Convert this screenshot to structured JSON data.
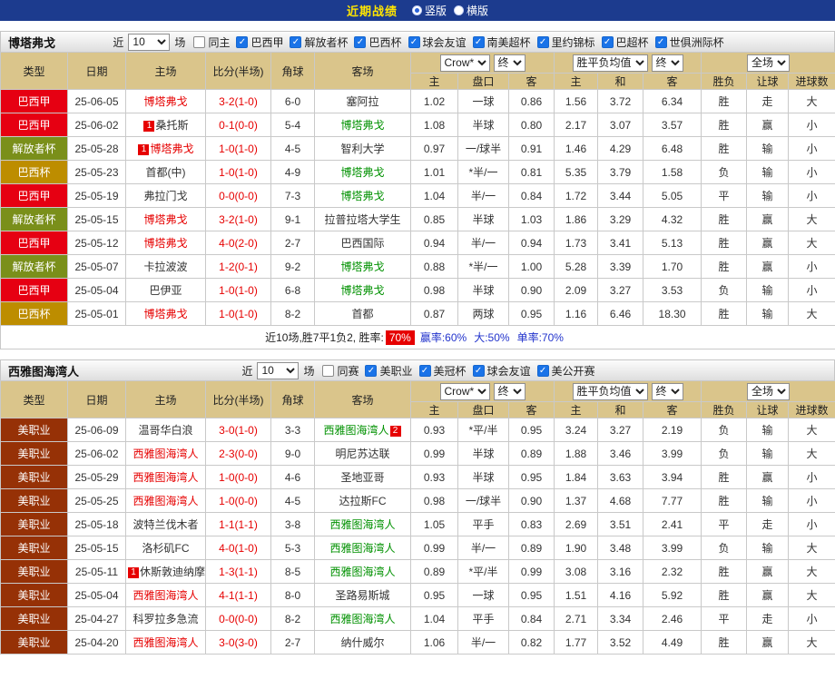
{
  "top_bar": {
    "title": "近期战绩",
    "layout_options": [
      {
        "label": "竖版",
        "selected": true
      },
      {
        "label": "横版",
        "selected": false
      }
    ]
  },
  "filter_labels": {
    "near": "近",
    "count": "10",
    "games": "场"
  },
  "table_headers": {
    "type": "类型",
    "date": "日期",
    "home": "主场",
    "score": "比分(半场)",
    "corners": "角球",
    "away": "客场",
    "odds_group": {
      "select1": "Crow*",
      "select2": "终"
    },
    "avg_group": {
      "select1": "胜平负均值",
      "select2": "终"
    },
    "result_group": {
      "select1": "全场"
    },
    "sub": [
      "主",
      "盘口",
      "客",
      "主",
      "和",
      "客",
      "胜负",
      "让球",
      "进球数"
    ]
  },
  "league_colors": {
    "巴西甲": "#e60012",
    "解放者杯": "#7a8f1a",
    "巴西杯": "#bd8d00",
    "美职业": "#963106"
  },
  "colors": {
    "positive_red": "#e60000",
    "negative_green": "#009100",
    "neutral_blue": "#3333cc",
    "header_tan": "#dac58b",
    "topbar_navy": "#1c3b8e",
    "title_yellow": "#ffe500"
  },
  "sections": [
    {
      "team": "博塔弗戈",
      "filters": [
        {
          "label": "同主",
          "checked": false
        },
        {
          "label": "巴西甲",
          "checked": true
        },
        {
          "label": "解放者杯",
          "checked": true
        },
        {
          "label": "巴西杯",
          "checked": true
        },
        {
          "label": "球会友谊",
          "checked": true
        },
        {
          "label": "南美超杯",
          "checked": true
        },
        {
          "label": "里约锦标",
          "checked": true
        },
        {
          "label": "巴超杯",
          "checked": true
        },
        {
          "label": "世俱洲际杯",
          "checked": true
        }
      ],
      "rows": [
        {
          "league": "巴西甲",
          "date": "25-06-05",
          "home": {
            "name": "博塔弗戈",
            "focus": true,
            "badge": null
          },
          "score": "3-2(1-0)",
          "corners": "6-0",
          "away": {
            "name": "塞阿拉",
            "focus": false,
            "badge": null
          },
          "odds": [
            "1.02",
            "一球",
            "0.86"
          ],
          "handicap_red": false,
          "avg": [
            "1.56",
            "3.72",
            "6.34"
          ],
          "results": [
            "胜",
            "走",
            "大"
          ]
        },
        {
          "league": "巴西甲",
          "date": "25-06-02",
          "home": {
            "name": "桑托斯",
            "focus": false,
            "badge": "1"
          },
          "score": "0-1(0-0)",
          "corners": "5-4",
          "away": {
            "name": "博塔弗戈",
            "focus": true,
            "badge": null
          },
          "odds": [
            "1.08",
            "半球",
            "0.80"
          ],
          "handicap_red": false,
          "avg": [
            "2.17",
            "3.07",
            "3.57"
          ],
          "results": [
            "胜",
            "赢",
            "小"
          ]
        },
        {
          "league": "解放者杯",
          "date": "25-05-28",
          "home": {
            "name": "博塔弗戈",
            "focus": true,
            "badge": "1"
          },
          "score": "1-0(1-0)",
          "corners": "4-5",
          "away": {
            "name": "智利大学",
            "focus": false,
            "badge": null
          },
          "odds": [
            "0.97",
            "一/球半",
            "0.91"
          ],
          "handicap_red": false,
          "avg": [
            "1.46",
            "4.29",
            "6.48"
          ],
          "results": [
            "胜",
            "输",
            "小"
          ]
        },
        {
          "league": "巴西杯",
          "date": "25-05-23",
          "home": {
            "name": "首都(中)",
            "focus": false,
            "badge": null
          },
          "score": "1-0(1-0)",
          "corners": "4-9",
          "away": {
            "name": "博塔弗戈",
            "focus": true,
            "badge": null
          },
          "odds": [
            "1.01",
            "*半/一",
            "0.81"
          ],
          "handicap_red": true,
          "avg": [
            "5.35",
            "3.79",
            "1.58"
          ],
          "results": [
            "负",
            "输",
            "小"
          ]
        },
        {
          "league": "巴西甲",
          "date": "25-05-19",
          "home": {
            "name": "弗拉门戈",
            "focus": false,
            "badge": null
          },
          "score": "0-0(0-0)",
          "corners": "7-3",
          "away": {
            "name": "博塔弗戈",
            "focus": true,
            "badge": null
          },
          "odds": [
            "1.04",
            "半/一",
            "0.84"
          ],
          "handicap_red": false,
          "avg": [
            "1.72",
            "3.44",
            "5.05"
          ],
          "results": [
            "平",
            "输",
            "小"
          ]
        },
        {
          "league": "解放者杯",
          "date": "25-05-15",
          "home": {
            "name": "博塔弗戈",
            "focus": true,
            "badge": null
          },
          "score": "3-2(1-0)",
          "corners": "9-1",
          "away": {
            "name": "拉普拉塔大学生",
            "focus": false,
            "badge": null
          },
          "odds": [
            "0.85",
            "半球",
            "1.03"
          ],
          "handicap_red": false,
          "avg": [
            "1.86",
            "3.29",
            "4.32"
          ],
          "results": [
            "胜",
            "赢",
            "大"
          ]
        },
        {
          "league": "巴西甲",
          "date": "25-05-12",
          "home": {
            "name": "博塔弗戈",
            "focus": true,
            "badge": null
          },
          "score": "4-0(2-0)",
          "corners": "2-7",
          "away": {
            "name": "巴西国际",
            "focus": false,
            "badge": null
          },
          "odds": [
            "0.94",
            "半/一",
            "0.94"
          ],
          "handicap_red": false,
          "avg": [
            "1.73",
            "3.41",
            "5.13"
          ],
          "results": [
            "胜",
            "赢",
            "大"
          ]
        },
        {
          "league": "解放者杯",
          "date": "25-05-07",
          "home": {
            "name": "卡拉波波",
            "focus": false,
            "badge": null
          },
          "score": "1-2(0-1)",
          "corners": "9-2",
          "away": {
            "name": "博塔弗戈",
            "focus": true,
            "badge": null
          },
          "odds": [
            "0.88",
            "*半/一",
            "1.00"
          ],
          "handicap_red": true,
          "avg": [
            "5.28",
            "3.39",
            "1.70"
          ],
          "results": [
            "胜",
            "赢",
            "小"
          ]
        },
        {
          "league": "巴西甲",
          "date": "25-05-04",
          "home": {
            "name": "巴伊亚",
            "focus": false,
            "badge": null
          },
          "score": "1-0(1-0)",
          "corners": "6-8",
          "away": {
            "name": "博塔弗戈",
            "focus": true,
            "badge": null
          },
          "odds": [
            "0.98",
            "半球",
            "0.90"
          ],
          "handicap_red": false,
          "avg": [
            "2.09",
            "3.27",
            "3.53"
          ],
          "results": [
            "负",
            "输",
            "小"
          ]
        },
        {
          "league": "巴西杯",
          "date": "25-05-01",
          "home": {
            "name": "博塔弗戈",
            "focus": true,
            "badge": null
          },
          "score": "1-0(1-0)",
          "corners": "8-2",
          "away": {
            "name": "首都",
            "focus": false,
            "badge": null
          },
          "odds": [
            "0.87",
            "两球",
            "0.95"
          ],
          "handicap_red": false,
          "avg": [
            "1.16",
            "6.46",
            "18.30"
          ],
          "results": [
            "胜",
            "输",
            "大"
          ]
        }
      ],
      "summary": {
        "text": "近10场,胜7平1负2, 胜率:",
        "win_rate": "70%",
        "stats": [
          "赢率:60%",
          "大:50%",
          "单率:70%"
        ]
      }
    },
    {
      "team": "西雅图海湾人",
      "filters": [
        {
          "label": "同赛",
          "checked": false
        },
        {
          "label": "美职业",
          "checked": true
        },
        {
          "label": "美冠杯",
          "checked": true
        },
        {
          "label": "球会友谊",
          "checked": true
        },
        {
          "label": "美公开赛",
          "checked": true
        }
      ],
      "rows": [
        {
          "league": "美职业",
          "date": "25-06-09",
          "home": {
            "name": "温哥华白浪",
            "focus": false,
            "badge": null
          },
          "score": "3-0(1-0)",
          "corners": "3-3",
          "away": {
            "name": "西雅图海湾人",
            "focus": true,
            "badge": "2"
          },
          "odds": [
            "0.93",
            "*平/半",
            "0.95"
          ],
          "handicap_red": true,
          "avg": [
            "3.24",
            "3.27",
            "2.19"
          ],
          "results": [
            "负",
            "输",
            "大"
          ]
        },
        {
          "league": "美职业",
          "date": "25-06-02",
          "home": {
            "name": "西雅图海湾人",
            "focus": true,
            "badge": null
          },
          "score": "2-3(0-0)",
          "corners": "9-0",
          "away": {
            "name": "明尼苏达联",
            "focus": false,
            "badge": null
          },
          "odds": [
            "0.99",
            "半球",
            "0.89"
          ],
          "handicap_red": false,
          "avg": [
            "1.88",
            "3.46",
            "3.99"
          ],
          "results": [
            "负",
            "输",
            "大"
          ]
        },
        {
          "league": "美职业",
          "date": "25-05-29",
          "home": {
            "name": "西雅图海湾人",
            "focus": true,
            "badge": null
          },
          "score": "1-0(0-0)",
          "corners": "4-6",
          "away": {
            "name": "圣地亚哥",
            "focus": false,
            "badge": null
          },
          "odds": [
            "0.93",
            "半球",
            "0.95"
          ],
          "handicap_red": false,
          "avg": [
            "1.84",
            "3.63",
            "3.94"
          ],
          "results": [
            "胜",
            "赢",
            "小"
          ]
        },
        {
          "league": "美职业",
          "date": "25-05-25",
          "home": {
            "name": "西雅图海湾人",
            "focus": true,
            "badge": null
          },
          "score": "1-0(0-0)",
          "corners": "4-5",
          "away": {
            "name": "达拉斯FC",
            "focus": false,
            "badge": null
          },
          "odds": [
            "0.98",
            "一/球半",
            "0.90"
          ],
          "handicap_red": false,
          "avg": [
            "1.37",
            "4.68",
            "7.77"
          ],
          "results": [
            "胜",
            "输",
            "小"
          ]
        },
        {
          "league": "美职业",
          "date": "25-05-18",
          "home": {
            "name": "波特兰伐木者",
            "focus": false,
            "badge": null
          },
          "score": "1-1(1-1)",
          "corners": "3-8",
          "away": {
            "name": "西雅图海湾人",
            "focus": true,
            "badge": null
          },
          "odds": [
            "1.05",
            "平手",
            "0.83"
          ],
          "handicap_red": false,
          "avg": [
            "2.69",
            "3.51",
            "2.41"
          ],
          "results": [
            "平",
            "走",
            "小"
          ]
        },
        {
          "league": "美职业",
          "date": "25-05-15",
          "home": {
            "name": "洛杉矶FC",
            "focus": false,
            "badge": null
          },
          "score": "4-0(1-0)",
          "corners": "5-3",
          "away": {
            "name": "西雅图海湾人",
            "focus": true,
            "badge": null
          },
          "odds": [
            "0.99",
            "半/一",
            "0.89"
          ],
          "handicap_red": false,
          "avg": [
            "1.90",
            "3.48",
            "3.99"
          ],
          "results": [
            "负",
            "输",
            "大"
          ]
        },
        {
          "league": "美职业",
          "date": "25-05-11",
          "home": {
            "name": "休斯敦迪纳摩",
            "focus": false,
            "badge": "1"
          },
          "score": "1-3(1-1)",
          "corners": "8-5",
          "away": {
            "name": "西雅图海湾人",
            "focus": true,
            "badge": null
          },
          "odds": [
            "0.89",
            "*平/半",
            "0.99"
          ],
          "handicap_red": true,
          "avg": [
            "3.08",
            "3.16",
            "2.32"
          ],
          "results": [
            "胜",
            "赢",
            "大"
          ]
        },
        {
          "league": "美职业",
          "date": "25-05-04",
          "home": {
            "name": "西雅图海湾人",
            "focus": true,
            "badge": null
          },
          "score": "4-1(1-1)",
          "corners": "8-0",
          "away": {
            "name": "圣路易斯城",
            "focus": false,
            "badge": null
          },
          "odds": [
            "0.95",
            "一球",
            "0.95"
          ],
          "handicap_red": false,
          "avg": [
            "1.51",
            "4.16",
            "5.92"
          ],
          "results": [
            "胜",
            "赢",
            "大"
          ]
        },
        {
          "league": "美职业",
          "date": "25-04-27",
          "home": {
            "name": "科罗拉多急流",
            "focus": false,
            "badge": null
          },
          "score": "0-0(0-0)",
          "corners": "8-2",
          "away": {
            "name": "西雅图海湾人",
            "focus": true,
            "badge": null
          },
          "odds": [
            "1.04",
            "平手",
            "0.84"
          ],
          "handicap_red": false,
          "avg": [
            "2.71",
            "3.34",
            "2.46"
          ],
          "results": [
            "平",
            "走",
            "小"
          ]
        },
        {
          "league": "美职业",
          "date": "25-04-20",
          "home": {
            "name": "西雅图海湾人",
            "focus": true,
            "badge": null
          },
          "score": "3-0(3-0)",
          "corners": "2-7",
          "away": {
            "name": "纳什威尔",
            "focus": false,
            "badge": null
          },
          "odds": [
            "1.06",
            "半/一",
            "0.82"
          ],
          "handicap_red": false,
          "avg": [
            "1.77",
            "3.52",
            "4.49"
          ],
          "results": [
            "胜",
            "赢",
            "大"
          ]
        }
      ],
      "summary": null
    }
  ]
}
